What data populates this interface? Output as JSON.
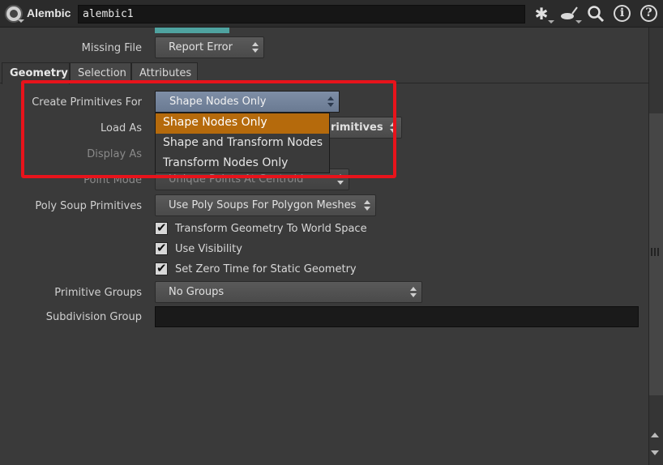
{
  "header": {
    "node_type": "Alembic",
    "node_name": "alembic1",
    "icons": [
      "gear-icon",
      "pan-icon",
      "search-icon",
      "info-icon",
      "help-icon"
    ],
    "info_glyph": "i",
    "help_glyph": "?"
  },
  "params": {
    "missing_file": {
      "label": "Missing File",
      "value": "Report Error"
    }
  },
  "tabs": [
    {
      "label": "Geometry",
      "active": true
    },
    {
      "label": "Selection",
      "active": false
    },
    {
      "label": "Attributes",
      "active": false
    }
  ],
  "geometry": {
    "create_primitives": {
      "label": "Create Primitives For",
      "value": "Shape Nodes Only"
    },
    "load_as": {
      "label": "Load As",
      "value_tail": "rimitives"
    },
    "display_as": {
      "label": "Display As"
    },
    "point_mode": {
      "label": "Point Mode",
      "value": "Unique Points At Centroid"
    },
    "poly_soup": {
      "label": "Poly Soup Primitives",
      "value": "Use Poly Soups For Polygon Meshes"
    },
    "checkboxes": [
      {
        "label": "Transform Geometry To World Space",
        "checked": true
      },
      {
        "label": "Use Visibility",
        "checked": true
      },
      {
        "label": "Set Zero Time for Static Geometry",
        "checked": true
      }
    ],
    "primitive_groups": {
      "label": "Primitive Groups",
      "value": "No Groups"
    },
    "subdivision_group": {
      "label": "Subdivision Group",
      "value": ""
    }
  },
  "popup": {
    "options": [
      "Shape Nodes Only",
      "Shape and Transform Nodes",
      "Transform Nodes Only"
    ],
    "selected_index": 0
  },
  "colors": {
    "highlight": "#e8131b",
    "selected_item": "#b56a0c",
    "dropdown_active": "#7e8ea6",
    "swatch": "#4fa3a0"
  }
}
